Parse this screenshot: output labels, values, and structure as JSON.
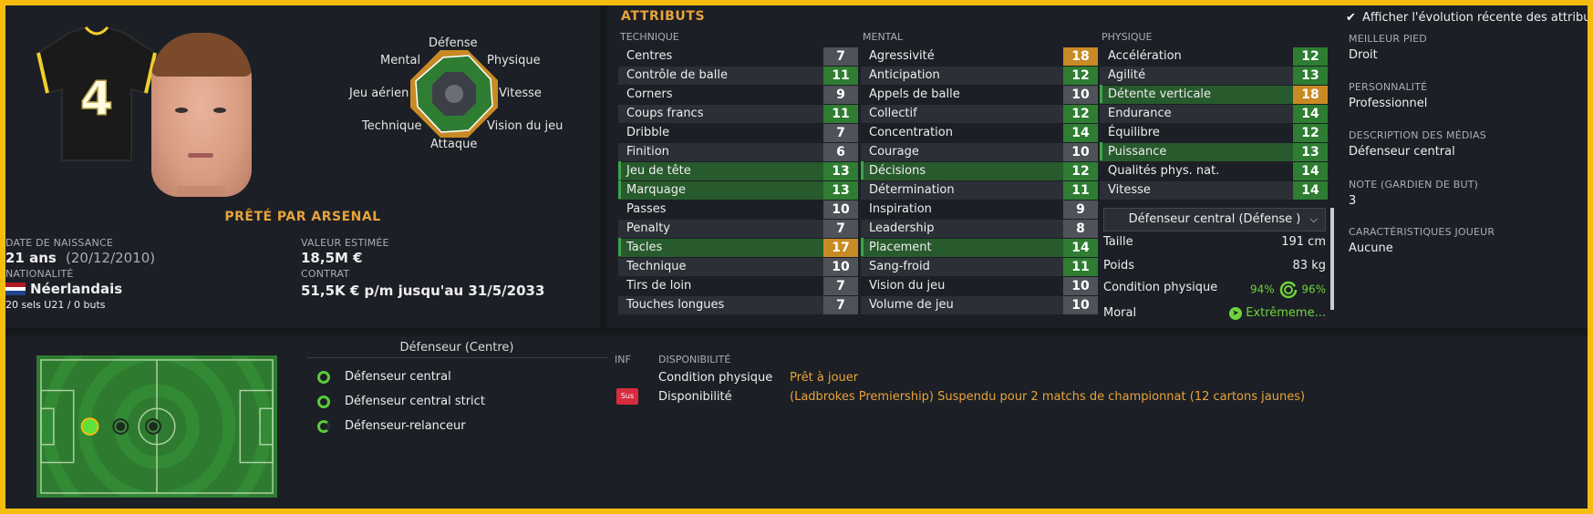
{
  "player": {
    "loan_label": "PRÊTÉ PAR ARSENAL",
    "shirt_number": "4",
    "radar_labels": {
      "defense": "Défense",
      "physique": "Physique",
      "vitesse": "Vitesse",
      "vision": "Vision du jeu",
      "attaque": "Attaque",
      "technique": "Technique",
      "aerien": "Jeu aérien",
      "mental": "Mental"
    },
    "birth": {
      "label": "DATE DE NAISSANCE",
      "age": "21 ans",
      "date": "(20/12/2010)"
    },
    "value": {
      "label": "VALEUR ESTIMÉE",
      "amount": "18,5M €"
    },
    "nationality": {
      "label": "NATIONALITÉ",
      "country": "Néerlandais",
      "caps": "20 sels U21 / 0 buts"
    },
    "contract": {
      "label": "CONTRAT",
      "text": "51,5K € p/m jusqu'au 31/5/2033"
    },
    "colors": {
      "accent": "#e8a33a",
      "flag_red": "#ae1c28",
      "flag_white": "#ffffff",
      "flag_blue": "#21468b"
    }
  },
  "attributes": {
    "title": "ATTRIBUTS",
    "technique": {
      "header": "TECHNIQUE",
      "items": [
        {
          "name": "Centres",
          "value": "7",
          "level": "grey",
          "hl": false
        },
        {
          "name": "Contrôle de balle",
          "value": "11",
          "level": "green",
          "hl": false
        },
        {
          "name": "Corners",
          "value": "9",
          "level": "grey",
          "hl": false
        },
        {
          "name": "Coups francs",
          "value": "11",
          "level": "green",
          "hl": false
        },
        {
          "name": "Dribble",
          "value": "7",
          "level": "grey",
          "hl": false
        },
        {
          "name": "Finition",
          "value": "6",
          "level": "grey",
          "hl": false
        },
        {
          "name": "Jeu de tête",
          "value": "13",
          "level": "green",
          "hl": true
        },
        {
          "name": "Marquage",
          "value": "13",
          "level": "green",
          "hl": true
        },
        {
          "name": "Passes",
          "value": "10",
          "level": "grey",
          "hl": false
        },
        {
          "name": "Penalty",
          "value": "7",
          "level": "grey",
          "hl": false
        },
        {
          "name": "Tacles",
          "value": "17",
          "level": "orange",
          "hl": true
        },
        {
          "name": "Technique",
          "value": "10",
          "level": "grey",
          "hl": false
        },
        {
          "name": "Tirs de loin",
          "value": "7",
          "level": "grey",
          "hl": false
        },
        {
          "name": "Touches longues",
          "value": "7",
          "level": "grey",
          "hl": false
        }
      ]
    },
    "mental": {
      "header": "MENTAL",
      "items": [
        {
          "name": "Agressivité",
          "value": "18",
          "level": "orange",
          "hl": false
        },
        {
          "name": "Anticipation",
          "value": "12",
          "level": "green",
          "hl": false
        },
        {
          "name": "Appels de balle",
          "value": "10",
          "level": "grey",
          "hl": false
        },
        {
          "name": "Collectif",
          "value": "12",
          "level": "green",
          "hl": false
        },
        {
          "name": "Concentration",
          "value": "14",
          "level": "green",
          "hl": false
        },
        {
          "name": "Courage",
          "value": "10",
          "level": "grey",
          "hl": false
        },
        {
          "name": "Décisions",
          "value": "12",
          "level": "green",
          "hl": true
        },
        {
          "name": "Détermination",
          "value": "11",
          "level": "green",
          "hl": false
        },
        {
          "name": "Inspiration",
          "value": "9",
          "level": "grey",
          "hl": false
        },
        {
          "name": "Leadership",
          "value": "8",
          "level": "grey",
          "hl": false
        },
        {
          "name": "Placement",
          "value": "14",
          "level": "green",
          "hl": true
        },
        {
          "name": "Sang-froid",
          "value": "11",
          "level": "green",
          "hl": false
        },
        {
          "name": "Vision du jeu",
          "value": "10",
          "level": "grey",
          "hl": false
        },
        {
          "name": "Volume de jeu",
          "value": "10",
          "level": "grey",
          "hl": false
        }
      ]
    },
    "physique": {
      "header": "PHYSIQUE",
      "items": [
        {
          "name": "Accélération",
          "value": "12",
          "level": "green",
          "hl": false
        },
        {
          "name": "Agilité",
          "value": "13",
          "level": "green",
          "hl": false
        },
        {
          "name": "Détente verticale",
          "value": "18",
          "level": "orange",
          "hl": true
        },
        {
          "name": "Endurance",
          "value": "14",
          "level": "green",
          "hl": false
        },
        {
          "name": "Équilibre",
          "value": "12",
          "level": "green",
          "hl": false
        },
        {
          "name": "Puissance",
          "value": "13",
          "level": "green",
          "hl": true
        },
        {
          "name": "Qualités phys. nat.",
          "value": "14",
          "level": "green",
          "hl": false
        },
        {
          "name": "Vitesse",
          "value": "14",
          "level": "green",
          "hl": false
        }
      ]
    },
    "role_select": "Défenseur central (Défense )",
    "height": {
      "label": "Taille",
      "value": "191 cm"
    },
    "weight": {
      "label": "Poids",
      "value": "83 kg"
    },
    "condition": {
      "label": "Condition physique",
      "value_a": "94%",
      "value_b": "96%"
    },
    "morale": {
      "label": "Moral",
      "value": "Extrêmeme..."
    },
    "toggle_label": "Afficher l'évolution récente des attributs"
  },
  "side": {
    "best_foot": {
      "label": "MEILLEUR PIED",
      "value": "Droit"
    },
    "personality": {
      "label": "PERSONNALITÉ",
      "value": "Professionnel"
    },
    "media": {
      "label": "DESCRIPTION DES MÉDIAS",
      "value": "Défenseur central"
    },
    "gk_rating": {
      "label": "NOTE (GARDIEN DE BUT)",
      "value": "3"
    },
    "traits": {
      "label": "CARACTÉRISTIQUES JOUEUR",
      "value": "Aucune"
    }
  },
  "positions": {
    "title": "Défenseur (Centre)",
    "roles": [
      {
        "name": "Défenseur central"
      },
      {
        "name": "Défenseur central strict"
      },
      {
        "name": "Défenseur-relanceur"
      }
    ]
  },
  "availability": {
    "inf_label": "INF",
    "header": "DISPONIBILITÉ",
    "rows": [
      {
        "label": "Condition physique",
        "value": "Prêt à jouer"
      },
      {
        "label": "Disponibilité",
        "value": "(Ladbrokes Premiership) Suspendu pour 2 matchs de championnat (12 cartons jaunes)"
      }
    ],
    "sus_badge": "Sus"
  }
}
